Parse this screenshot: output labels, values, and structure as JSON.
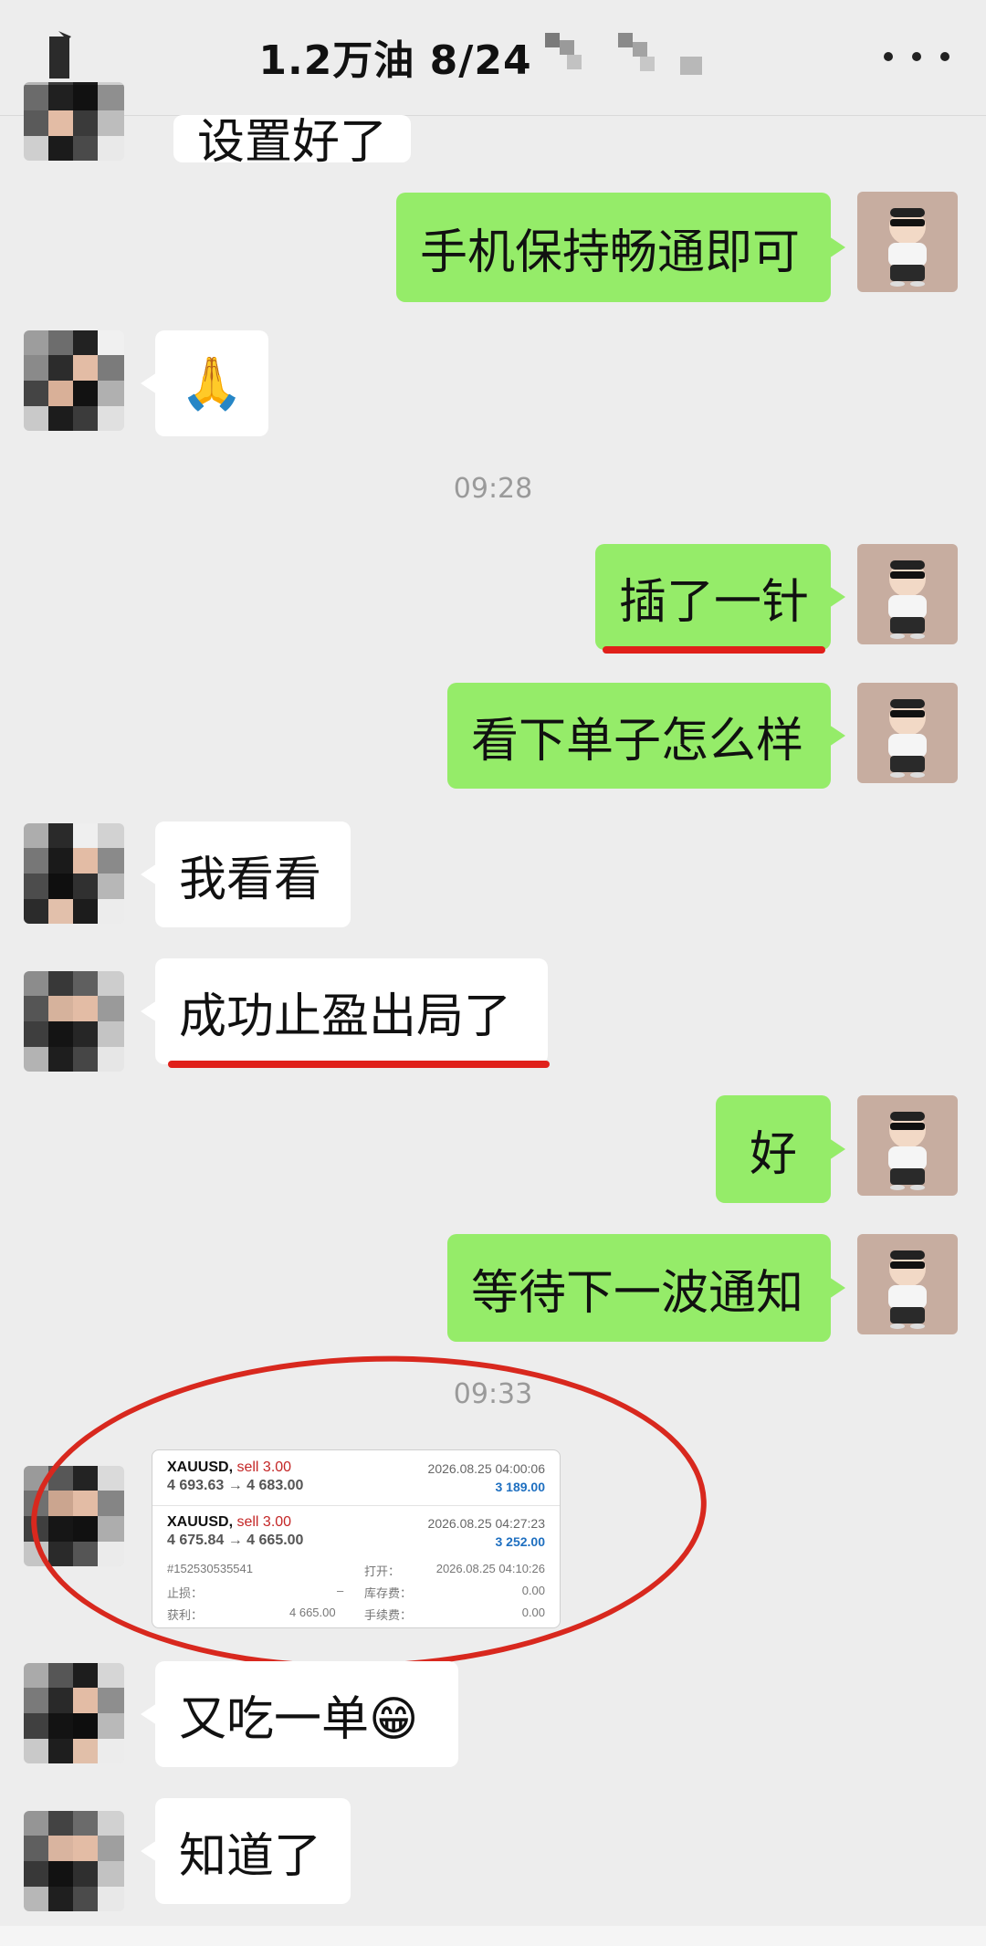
{
  "header": {
    "title": "1.2万油  8/24",
    "back_icon": "back-icon",
    "more_icon": "more-dots-icon"
  },
  "messages": [
    {
      "side": "left",
      "text": "设置好了",
      "partial": true
    },
    {
      "side": "right",
      "text": "手机保持畅通即可"
    },
    {
      "side": "left",
      "text": "🙏",
      "emoji": "folded-hands-emoji"
    },
    {
      "type": "time",
      "text": "09:28"
    },
    {
      "side": "right",
      "text": "插了一针",
      "underlined": true
    },
    {
      "side": "right",
      "text": "看下单子怎么样"
    },
    {
      "side": "left",
      "text": "我看看"
    },
    {
      "side": "left",
      "text": "成功止盈出局了",
      "underlined": true
    },
    {
      "side": "right",
      "text": "好"
    },
    {
      "side": "right",
      "text": "等待下一波通知"
    },
    {
      "type": "time",
      "text": "09:33"
    },
    {
      "side": "left",
      "type": "image",
      "highlighted": true
    },
    {
      "side": "left",
      "text": "又吃一单😁"
    },
    {
      "side": "left",
      "text": "知道了"
    }
  ],
  "trade_card": {
    "trade1": {
      "symbol": "XAUUSD,",
      "side": "sell 3.00",
      "prices": "4 693.63 → 4 683.00",
      "time": "2026.08.25 04:00:06",
      "profit": "3 189.00"
    },
    "trade2": {
      "symbol": "XAUUSD,",
      "side": "sell 3.00",
      "prices": "4 675.84 → 4 665.00",
      "time": "2026.08.25 04:27:23",
      "profit": "3 252.00"
    },
    "order_id": "#152530535541",
    "open_label": "打开：",
    "open_time": "2026.08.25 04:10:26",
    "sl_label": "止损：",
    "sl_value": "–",
    "swap_label": "库存费：",
    "swap_value": "0.00",
    "tp_label": "获利：",
    "tp_value": "4 665.00",
    "fee_label": "手续费：",
    "fee_value": "0.00"
  },
  "colors": {
    "background": "#ededed",
    "sent_bubble": "#95ec69",
    "received_bubble": "#ffffff",
    "highlight_red": "#d8281e"
  }
}
